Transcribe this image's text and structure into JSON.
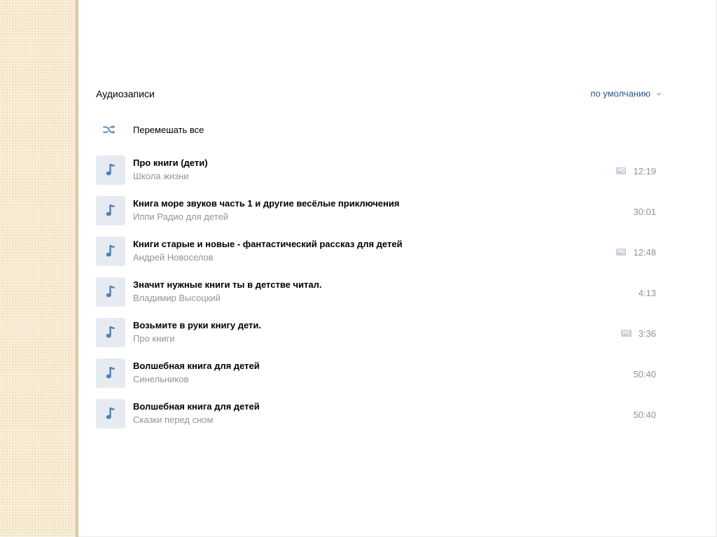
{
  "header": {
    "title": "Аудиозаписи",
    "sort_label": "по умолчанию"
  },
  "shuffle": {
    "label": "Перемешать все",
    "icon": "shuffle-icon"
  },
  "colors": {
    "accent": "#2a5885",
    "cover_bg": "#e5ebf1",
    "note_icon": "#5181b8",
    "secondary_text": "#939393",
    "hq_badge": "#c5d0db"
  },
  "hq_label": "HQ",
  "tracks": [
    {
      "title": "Про книги (дети)",
      "artist": "Школа жизни",
      "duration": "12:19",
      "hq": true
    },
    {
      "title": "Книга море звуков часть 1 и другие весёлые приключения",
      "artist": "Иппи Радио для детей",
      "duration": "30:01",
      "hq": false
    },
    {
      "title": "Книги старые и новые - фантастический рассказ для детей",
      "artist": "Андрей Новоселов",
      "duration": "12:48",
      "hq": true
    },
    {
      "title": "Значит нужные книги ты в детстве читал.",
      "artist": "Владимир Высоцкий",
      "duration": "4:13",
      "hq": false
    },
    {
      "title": "Возьмите в руки книгу дети.",
      "artist": "Про книги",
      "duration": "3:36",
      "hq": true
    },
    {
      "title": "Волшебная книга для детей",
      "artist": "Синельников",
      "duration": "50:40",
      "hq": false
    },
    {
      "title": "Волшебная книга для детей",
      "artist": "Сказки перед сном",
      "duration": "50:40",
      "hq": false
    }
  ]
}
